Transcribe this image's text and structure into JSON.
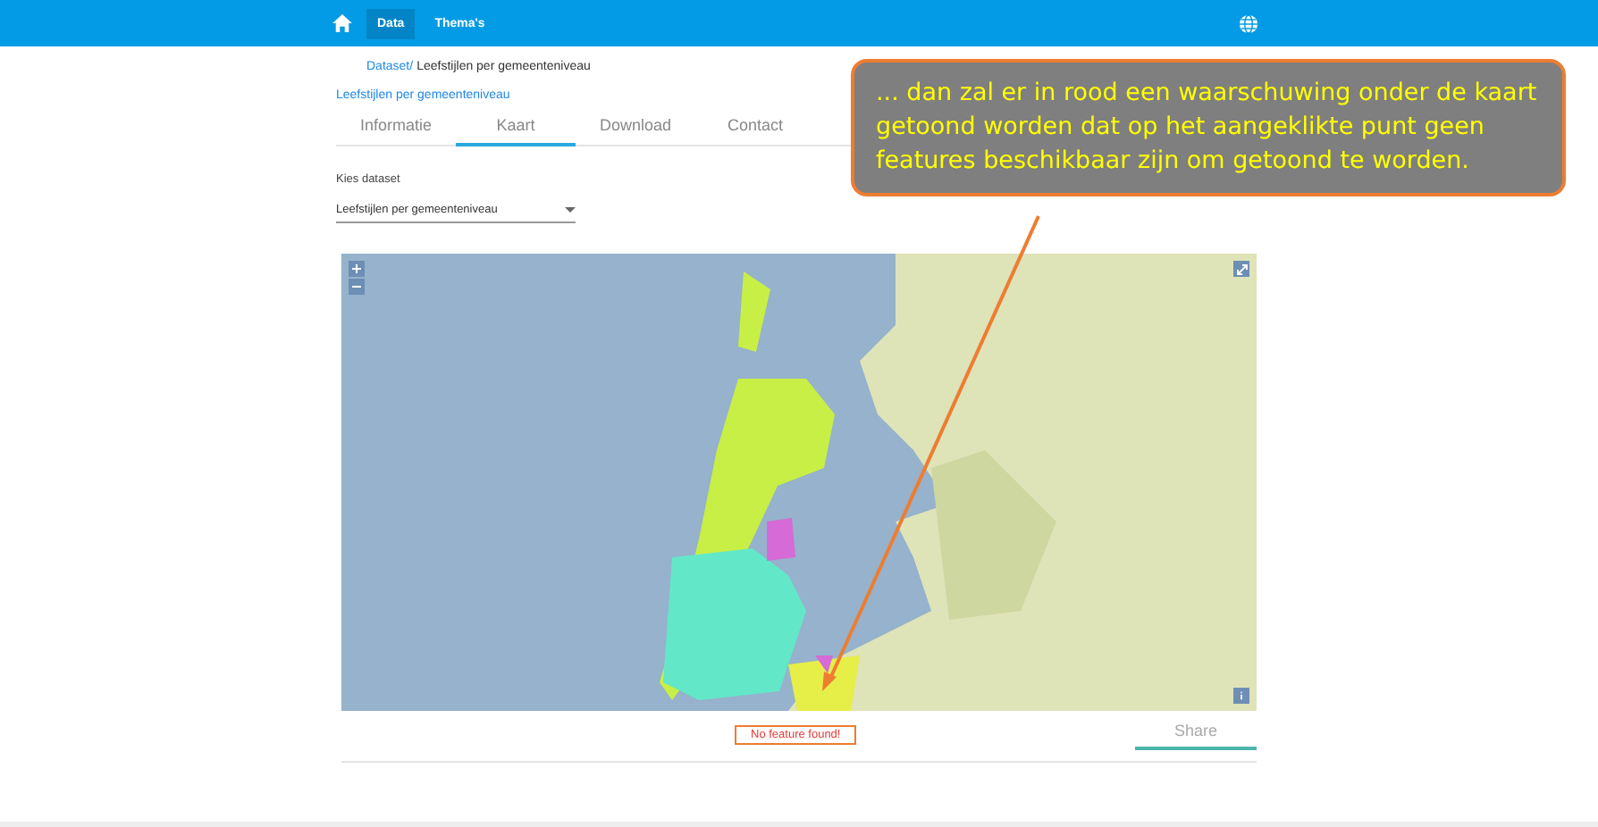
{
  "nav": {
    "items": [
      {
        "label": "Data",
        "selected": true
      },
      {
        "label": "Thema's",
        "selected": false
      }
    ]
  },
  "breadcrumb": {
    "link": "Dataset/",
    "current": "Leefstijlen per gemeenteniveau"
  },
  "dataset_title": "Leefstijlen per gemeenteniveau",
  "tabs": [
    {
      "label": "Informatie",
      "selected": false
    },
    {
      "label": "Kaart",
      "selected": true
    },
    {
      "label": "Download",
      "selected": false
    },
    {
      "label": "Contact",
      "selected": false
    }
  ],
  "dataset_select": {
    "label": "Kies dataset",
    "value": "Leefstijlen per gemeenteniveau"
  },
  "map": {
    "warning": "No feature found!"
  },
  "bottom_tabs": [
    {
      "label": "Share",
      "selected": true
    }
  ],
  "callout": {
    "text": "... dan zal er in rood een waarschuwing onder de kaart getoond worden dat op het aangeklikte punt geen features beschikbaar zijn om getoond te worden."
  }
}
